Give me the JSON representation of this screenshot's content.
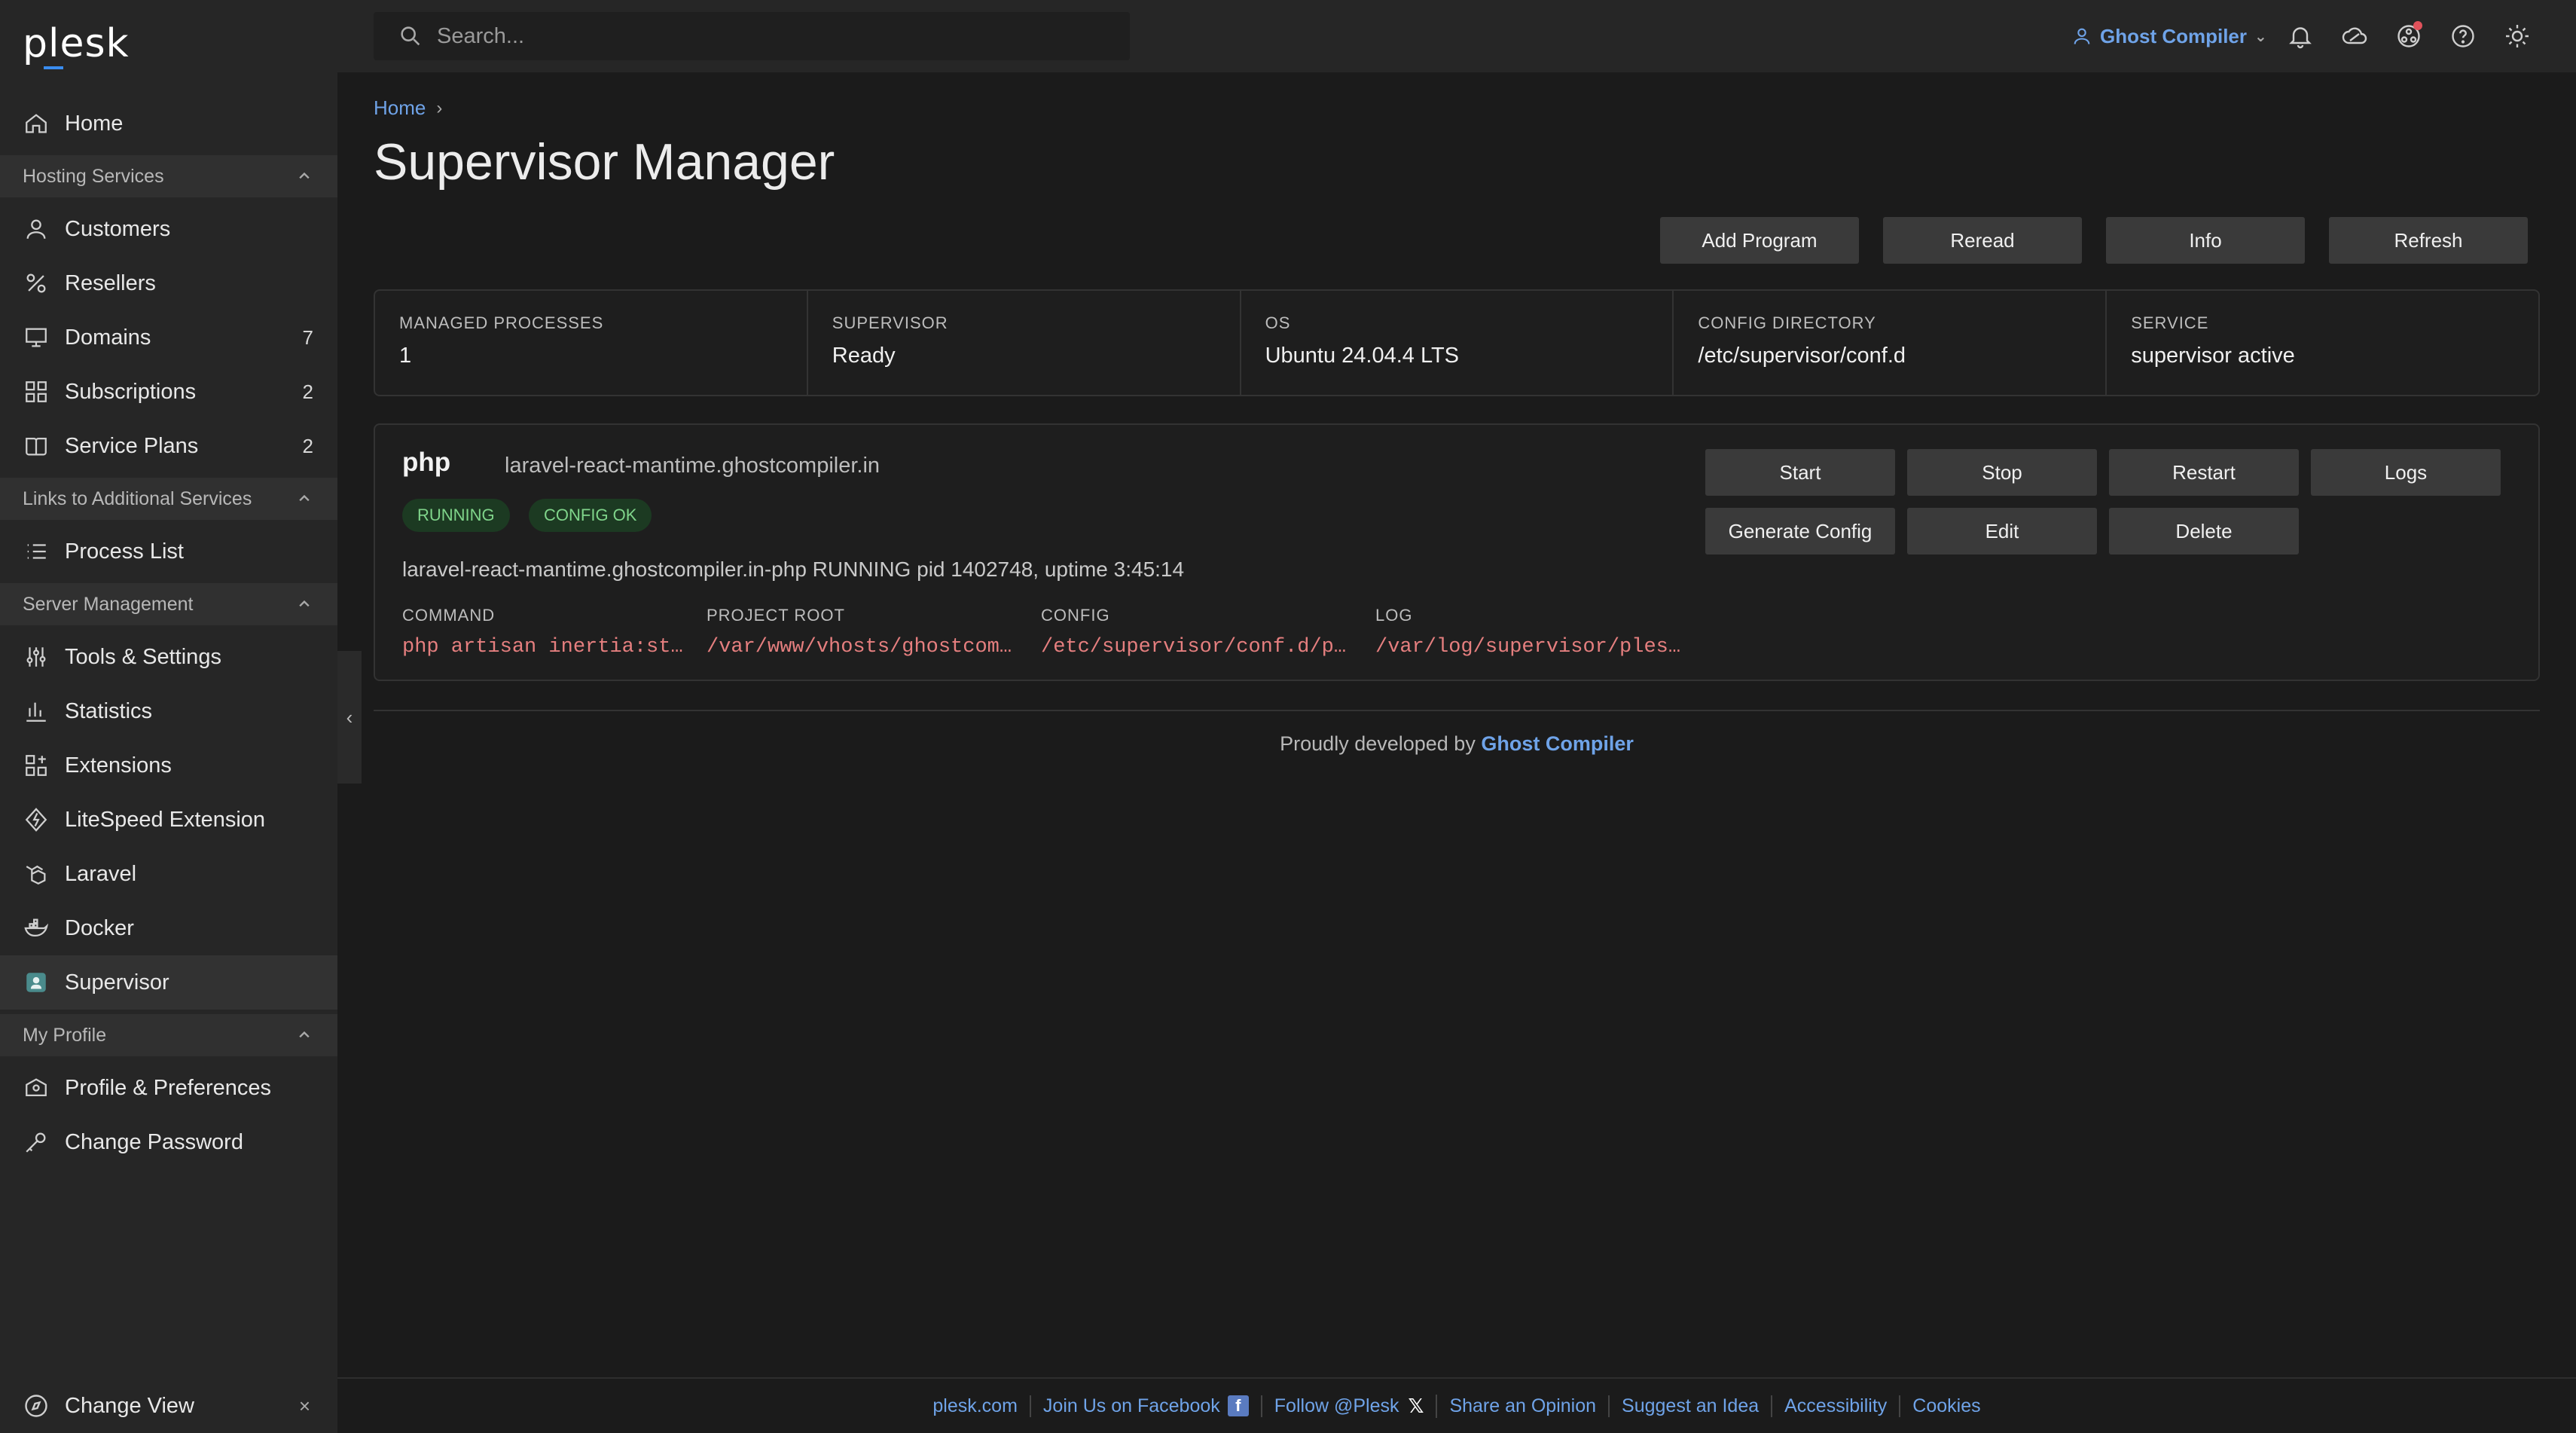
{
  "app": {
    "logo": "plesk"
  },
  "search": {
    "placeholder": "Search..."
  },
  "user": {
    "name": "Ghost Compiler"
  },
  "sidebar": {
    "items_top": [
      {
        "label": "Home",
        "icon": "home-icon"
      }
    ],
    "sections": [
      {
        "title": "Hosting Services",
        "items": [
          {
            "label": "Customers",
            "icon": "user-icon",
            "count": ""
          },
          {
            "label": "Resellers",
            "icon": "percent-icon",
            "count": ""
          },
          {
            "label": "Domains",
            "icon": "monitor-icon",
            "count": "7"
          },
          {
            "label": "Subscriptions",
            "icon": "grid-icon",
            "count": "2"
          },
          {
            "label": "Service Plans",
            "icon": "book-icon",
            "count": "2"
          }
        ]
      },
      {
        "title": "Links to Additional Services",
        "items": [
          {
            "label": "Process List",
            "icon": "list-icon",
            "count": ""
          }
        ]
      },
      {
        "title": "Server Management",
        "items": [
          {
            "label": "Tools & Settings",
            "icon": "sliders-icon"
          },
          {
            "label": "Statistics",
            "icon": "bar-chart-icon"
          },
          {
            "label": "Extensions",
            "icon": "extensions-icon"
          },
          {
            "label": "LiteSpeed Extension",
            "icon": "litespeed-icon"
          },
          {
            "label": "Laravel",
            "icon": "laravel-icon"
          },
          {
            "label": "Docker",
            "icon": "docker-icon"
          },
          {
            "label": "Supervisor",
            "icon": "supervisor-icon"
          }
        ]
      },
      {
        "title": "My Profile",
        "items": [
          {
            "label": "Profile & Preferences",
            "icon": "profile-icon"
          },
          {
            "label": "Change Password",
            "icon": "key-icon"
          }
        ]
      }
    ],
    "change_view": "Change View",
    "close": "×"
  },
  "breadcrumb": {
    "home": "Home"
  },
  "page": {
    "title": "Supervisor Manager",
    "actions": {
      "add": "Add Program",
      "reread": "Reread",
      "info": "Info",
      "refresh": "Refresh"
    }
  },
  "stats": [
    {
      "label": "MANAGED PROCESSES",
      "value": "1"
    },
    {
      "label": "SUPERVISOR",
      "value": "Ready"
    },
    {
      "label": "OS",
      "value": "Ubuntu 24.04.4 LTS"
    },
    {
      "label": "CONFIG DIRECTORY",
      "value": "/etc/supervisor/conf.d"
    },
    {
      "label": "SERVICE",
      "value": "supervisor active"
    }
  ],
  "program": {
    "name": "php",
    "domain": "laravel-react-mantime.ghostcompiler.in",
    "badges": {
      "running": "RUNNING",
      "config": "CONFIG OK"
    },
    "status_line": "laravel-react-mantime.ghostcompiler.in-php RUNNING pid 1402748, uptime 3:45:14",
    "buttons": {
      "start": "Start",
      "stop": "Stop",
      "restart": "Restart",
      "logs": "Logs",
      "generate": "Generate Config",
      "edit": "Edit",
      "delete": "Delete"
    },
    "meta": {
      "command_label": "COMMAND",
      "command": "php artisan inertia:sta…",
      "root_label": "PROJECT ROOT",
      "root": "/var/www/vhosts/ghostcomp…",
      "config_label": "CONFIG",
      "config": "/etc/supervisor/conf.d/pl…",
      "log_label": "LOG",
      "log": "/var/log/supervisor/plesk…"
    }
  },
  "credit": {
    "prefix": "Proudly developed by",
    "author": "Ghost Compiler"
  },
  "footer": {
    "links": [
      "plesk.com",
      "Join Us on Facebook",
      "Follow @Plesk",
      "Share an Opinion",
      "Suggest an Idea",
      "Accessibility",
      "Cookies"
    ]
  },
  "colors": {
    "accent": "#6fa3e8",
    "badge_bg": "#1c3a22",
    "badge_text": "#7fd48a",
    "code": "#e57f7f"
  }
}
